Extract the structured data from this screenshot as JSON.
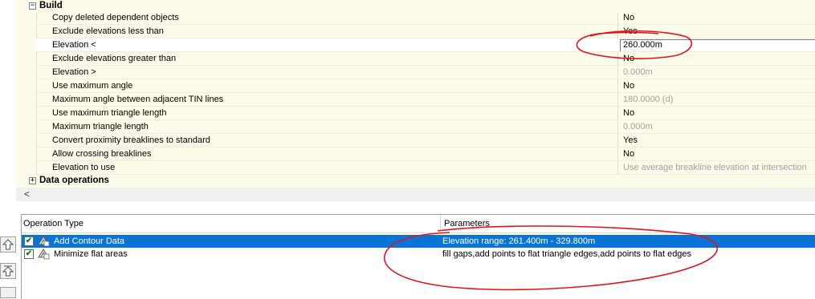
{
  "build": {
    "toggle": "−",
    "label": "Build",
    "properties": [
      {
        "name": "Copy deleted dependent objects",
        "value": "No",
        "readonly": false
      },
      {
        "name": "Exclude elevations less than",
        "value": "Yes",
        "readonly": false
      },
      {
        "name": "Elevation <",
        "value": "260.000m",
        "readonly": false,
        "selected": true
      },
      {
        "name": "Exclude elevations greater than",
        "value": "No",
        "readonly": false
      },
      {
        "name": "Elevation >",
        "value": "0.000m",
        "readonly": true
      },
      {
        "name": "Use maximum angle",
        "value": "No",
        "readonly": false
      },
      {
        "name": "Maximum angle between adjacent TIN lines",
        "value": "180.0000 (d)",
        "readonly": true
      },
      {
        "name": "Use maximum triangle length",
        "value": "No",
        "readonly": false
      },
      {
        "name": "Maximum triangle length",
        "value": "0.000m",
        "readonly": true
      },
      {
        "name": "Convert proximity breaklines to standard",
        "value": "Yes",
        "readonly": false
      },
      {
        "name": "Allow crossing breaklines",
        "value": "No",
        "readonly": false
      },
      {
        "name": "Elevation to use",
        "value": "Use average breakline elevation at intersection",
        "readonly": true
      }
    ]
  },
  "data_operations": {
    "toggle": "+",
    "label": "Data operations"
  },
  "hscroll": {
    "left_arrow": "<"
  },
  "operations": {
    "columns": {
      "type": "Operation Type",
      "params": "Parameters"
    },
    "rows": [
      {
        "name": "Add Contour Data",
        "params": "Elevation range: 261.400m - 329.800m",
        "checked": "✔",
        "selected": true
      },
      {
        "name": "Minimize flat areas",
        "params": "fill gaps,add points to flat triangle edges,add points to flat edges",
        "checked": "✔",
        "selected": false
      }
    ]
  },
  "colors": {
    "selection": "#0a74d6",
    "grid_bg": "#fdfbe9",
    "annotation": "#e0141e"
  }
}
